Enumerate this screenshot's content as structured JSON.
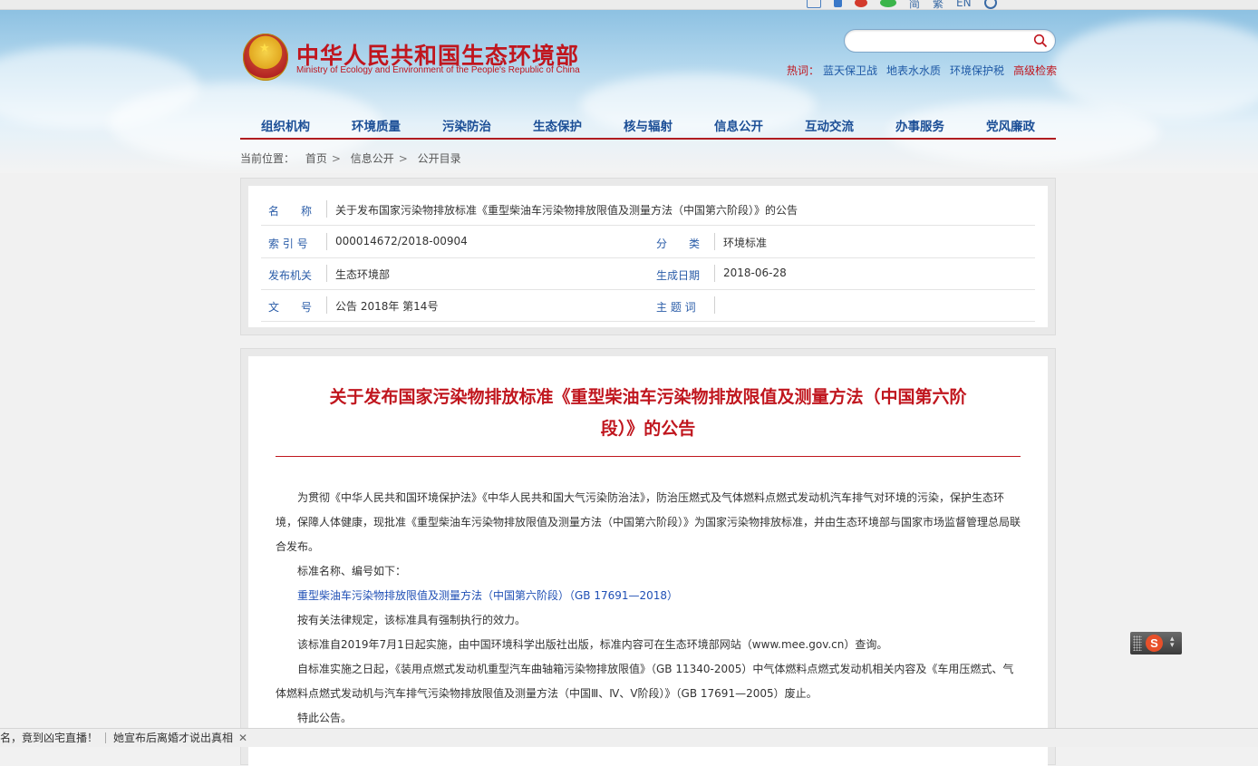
{
  "top_strip": {
    "icons": [
      "mail-icon",
      "mobile-icon",
      "weibo-icon",
      "wechat-icon"
    ],
    "links": [
      {
        "name": "simplified-chinese-link",
        "label": "简"
      },
      {
        "name": "traditional-chinese-link",
        "label": "繁"
      },
      {
        "name": "english-link",
        "label": "EN"
      }
    ]
  },
  "header": {
    "site_title": "中华人民共和国生态环境部",
    "site_subtitle": "Ministry of Ecology and Environment of the People's Republic of China",
    "search_placeholder": "",
    "hot_label": "热词：",
    "hot_items": [
      "蓝天保卫战",
      "地表水水质",
      "环境保护税"
    ],
    "advanced_search": "高级检索"
  },
  "nav": {
    "items": [
      "组织机构",
      "环境质量",
      "污染防治",
      "生态保护",
      "核与辐射",
      "信息公开",
      "互动交流",
      "办事服务",
      "党风廉政"
    ]
  },
  "breadcrumb": {
    "prefix": "当前位置：",
    "items": [
      "首页",
      "信息公开",
      "公开目录"
    ],
    "separator": ">"
  },
  "meta": {
    "name_label": "名　　称",
    "name_value": "关于发布国家污染物排放标准《重型柴油车污染物排放限值及测量方法（中国第六阶段）》的公告",
    "index_label": "索 引 号",
    "index_value": "000014672/2018-00904",
    "category_label": "分　　类",
    "category_value": "环境标准",
    "issuer_label": "发布机关",
    "issuer_value": "生态环境部",
    "date_label": "生成日期",
    "date_value": "2018-06-28",
    "docno_label": "文　　号",
    "docno_value": "公告 2018年 第14号",
    "topic_label": "主 题 词",
    "topic_value": ""
  },
  "article": {
    "title_line1": "关于发布国家污染物排放标准《重型柴油车污染物排放限值及测量方法（中国第六阶",
    "title_line2": "段）》的公告",
    "p1": "为贯彻《中华人民共和国环境保护法》《中华人民共和国大气污染防治法》，防治压燃式及气体燃料点燃式发动机汽车排气对环境的污染，保护生态环境，保障人体健康，现批准《重型柴油车污染物排放限值及测量方法（中国第六阶段）》为国家污染物排放标准，并由生态环境部与国家市场监督管理总局联合发布。",
    "p2": "标准名称、编号如下：",
    "p3_link": "重型柴油车污染物排放限值及测量方法（中国第六阶段）（GB 17691—2018）",
    "p4": "按有关法律规定，该标准具有强制执行的效力。",
    "p5": "该标准自2019年7月1日起实施，由中国环境科学出版社出版，标准内容可在生态环境部网站（www.mee.gov.cn）查询。",
    "p6": "自标准实施之日起，《装用点燃式发动机重型汽车曲轴箱污染物排放限值》（GB 11340-2005）中气体燃料点燃式发动机相关内容及《车用压燃式、气体燃料点燃式发动机与汽车排气污染物排放限值及测量方法（中国Ⅲ、Ⅳ、Ⅴ阶段）》（GB 17691—2005）废止。",
    "p7": "特此公告。"
  },
  "ime": {
    "logo": "S"
  },
  "ticker": {
    "item1": "名，竟到凶宅直播！",
    "item2": "她宣布后离婚才说出真相",
    "close": "✕"
  },
  "colors": {
    "brand_red": "#c0161e",
    "nav_blue": "#1b4e96",
    "label_blue": "#2a5ca8",
    "link_blue": "#1f4fb5"
  }
}
